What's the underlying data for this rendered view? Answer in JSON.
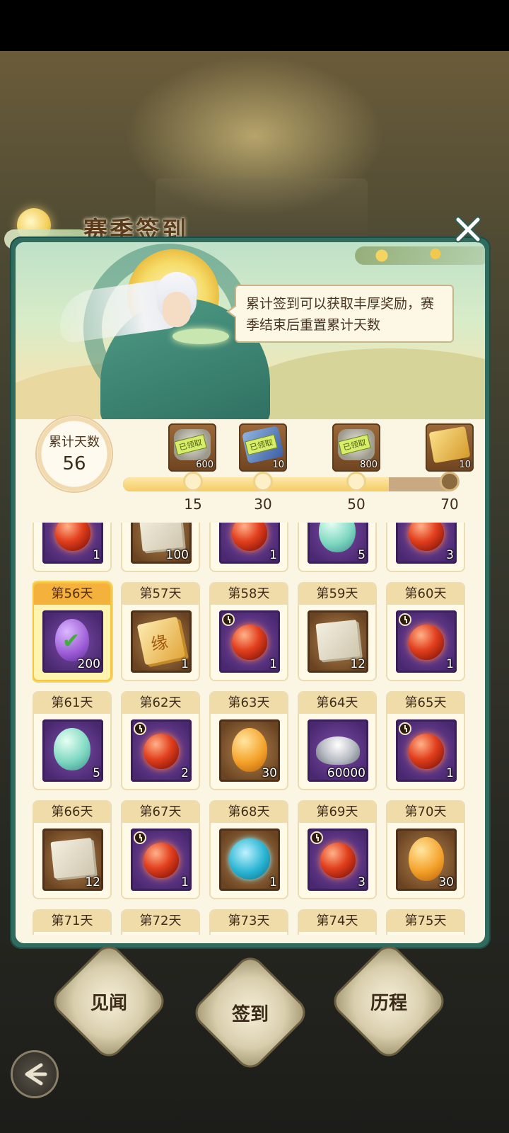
{
  "title": "赛季签到",
  "tip": "累计签到可以获取丰厚奖励，赛季结束后重置累计天数",
  "counter": {
    "label": "累计天数",
    "value": "56"
  },
  "progress": {
    "current": 56,
    "max": 70
  },
  "milestones": [
    {
      "day": "15",
      "qty": "600",
      "stamp": "已领取",
      "icon": "silver-ingot-icon"
    },
    {
      "day": "30",
      "qty": "10",
      "stamp": "已领取",
      "icon": "blue-ticket-icon"
    },
    {
      "day": "50",
      "qty": "800",
      "stamp": "已领取",
      "icon": "silver-ingot-icon"
    },
    {
      "day": "70",
      "qty": "10",
      "stamp": "",
      "icon": "fate-scroll-icon",
      "glyph": "缘"
    }
  ],
  "partial_row": [
    "1",
    "100",
    "1",
    "5",
    "3"
  ],
  "days": [
    {
      "label": "第56天",
      "qty": "200",
      "icon": "purple-egg-claimed-icon",
      "current": true
    },
    {
      "label": "第57天",
      "qty": "1",
      "icon": "fate-scroll-icon",
      "glyph": "缘"
    },
    {
      "label": "第58天",
      "qty": "1",
      "icon": "fire-orb-icon"
    },
    {
      "label": "第59天",
      "qty": "12",
      "icon": "paper-stack-icon"
    },
    {
      "label": "第60天",
      "qty": "1",
      "icon": "fire-orb-icon"
    },
    {
      "label": "第61天",
      "qty": "5",
      "icon": "jade-egg-icon"
    },
    {
      "label": "第62天",
      "qty": "2",
      "icon": "fire-orb-icon"
    },
    {
      "label": "第63天",
      "qty": "30",
      "icon": "amber-egg-icon"
    },
    {
      "label": "第64天",
      "qty": "60000",
      "icon": "silver-ingot-icon"
    },
    {
      "label": "第65天",
      "qty": "1",
      "icon": "fire-orb-icon"
    },
    {
      "label": "第66天",
      "qty": "12",
      "icon": "paper-stack-icon"
    },
    {
      "label": "第67天",
      "qty": "1",
      "icon": "fire-orb-icon"
    },
    {
      "label": "第68天",
      "qty": "1",
      "icon": "jade-disc-icon"
    },
    {
      "label": "第69天",
      "qty": "3",
      "icon": "fire-orb-icon"
    },
    {
      "label": "第70天",
      "qty": "30",
      "icon": "amber-egg-icon"
    },
    {
      "label": "第71天",
      "qty": "",
      "icon": "unknown-item-icon"
    },
    {
      "label": "第72天",
      "qty": "",
      "icon": "fire-orb-icon"
    },
    {
      "label": "第73天",
      "qty": "",
      "icon": "red-bundle-icon"
    },
    {
      "label": "第74天",
      "qty": "",
      "icon": "fire-orb-icon"
    },
    {
      "label": "第75天",
      "qty": "",
      "icon": "brown-item-icon"
    }
  ],
  "nav": {
    "left": "见闻",
    "center": "签到",
    "right": "历程"
  }
}
